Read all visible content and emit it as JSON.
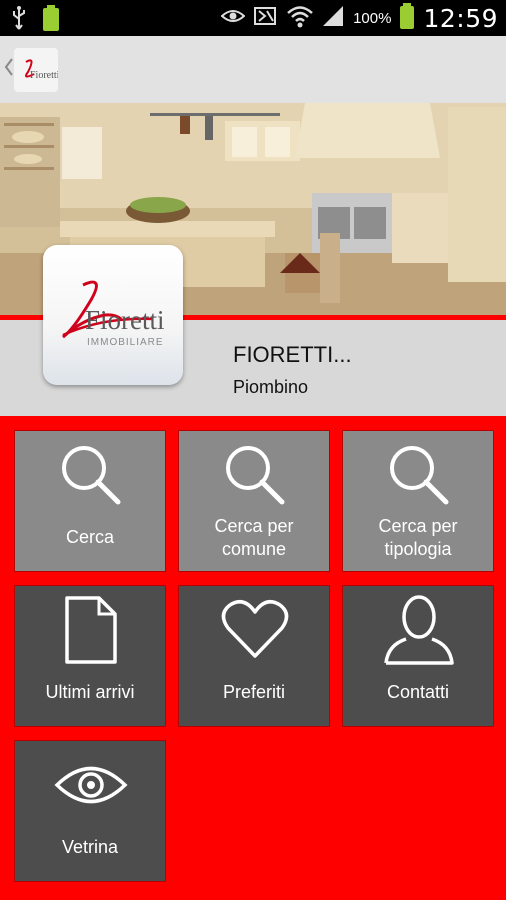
{
  "status_bar": {
    "battery_percent": "100%",
    "time": "12:59",
    "icons": [
      "usb-icon",
      "battery-small-icon",
      "eye-icon",
      "mute-icon",
      "wifi-icon",
      "signal-icon",
      "battery-icon"
    ]
  },
  "action_bar": {
    "back_icon": "chevron-left-icon",
    "logo_brand": "Fioretti"
  },
  "header": {
    "logo_brand": "Fioretti",
    "logo_sub": "IMMOBILIARE",
    "company_name": "FIORETTI...",
    "company_city": "Piombino"
  },
  "menu": {
    "tiles": [
      {
        "label_line1": "Cerca",
        "label_line2": "",
        "icon": "search-icon"
      },
      {
        "label_line1": "Cerca per",
        "label_line2": "comune",
        "icon": "search-icon"
      },
      {
        "label_line1": "Cerca per",
        "label_line2": "tipologia",
        "icon": "search-icon"
      },
      {
        "label_line1": "Ultimi arrivi",
        "label_line2": "",
        "icon": "document-icon"
      },
      {
        "label_line1": "Preferiti",
        "label_line2": "",
        "icon": "heart-icon"
      },
      {
        "label_line1": "Contatti",
        "label_line2": "",
        "icon": "person-icon"
      },
      {
        "label_line1": "Vetrina",
        "label_line2": "",
        "icon": "eye-icon"
      }
    ]
  },
  "colors": {
    "background": "#ff0000",
    "tile_light": "#8a8a8a",
    "tile_dark": "#4d4d4d",
    "info_band": "#d8d8d8",
    "action_bar": "#e2e2e2"
  }
}
